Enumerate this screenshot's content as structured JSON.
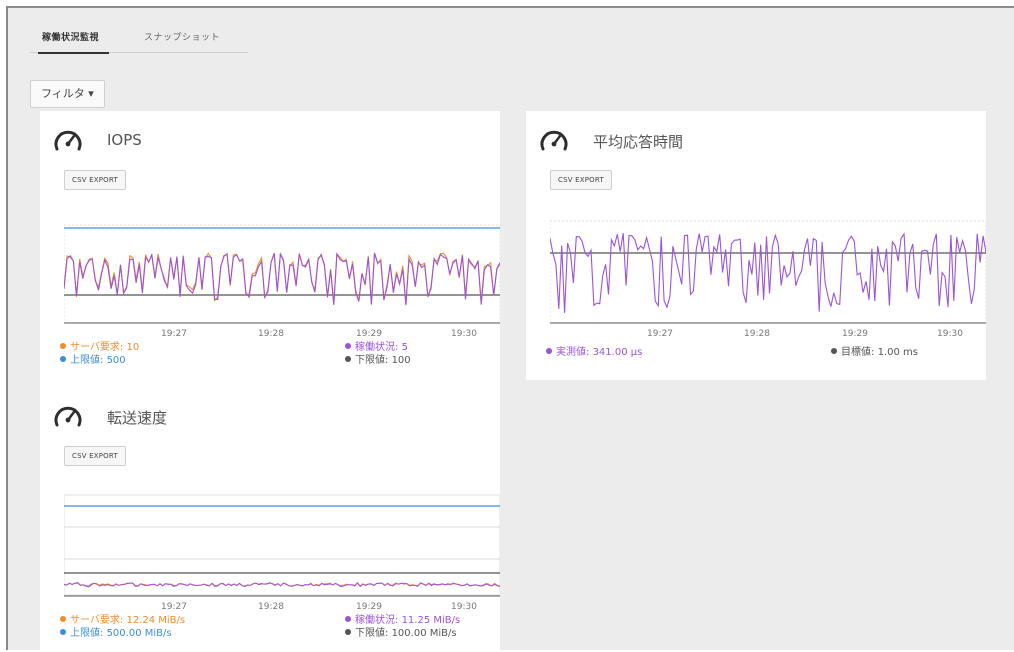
{
  "tabs": [
    {
      "label": "稼働状況監視",
      "active": true
    },
    {
      "label": "スナップショット",
      "active": false
    }
  ],
  "filter": {
    "label": "フィルタ ▾"
  },
  "colors": {
    "orange": "#f28c28",
    "purple": "#9a55d6",
    "blue": "#3c8fd6",
    "gray": "#555555",
    "band": "#e6e6e6"
  },
  "panels": [
    {
      "id": "iops",
      "title": "IOPS",
      "csv_label": "CSV EXPORT",
      "x_ticks": [
        "19:27",
        "19:28",
        "19:29",
        "19:30"
      ],
      "legend": [
        {
          "label": "サーバ要求:",
          "value": "10",
          "color": "orange"
        },
        {
          "label": "稼働状況:",
          "value": "5",
          "color": "purple"
        },
        {
          "label": "上限値:",
          "value": "500",
          "color": "blue"
        },
        {
          "label": "下限値:",
          "value": "100",
          "color": "gray"
        }
      ]
    },
    {
      "id": "response",
      "title": "平均応答時間",
      "csv_label": "CSV EXPORT",
      "x_ticks": [
        "19:27",
        "19:28",
        "19:29",
        "19:30"
      ],
      "legend": [
        {
          "label": "実測値:",
          "value": "341.00 μs",
          "color": "purple"
        },
        {
          "label": "目標値:",
          "value": "1.00 ms",
          "color": "gray"
        }
      ]
    },
    {
      "id": "transfer",
      "title": "転送速度",
      "csv_label": "CSV EXPORT",
      "x_ticks": [
        "19:27",
        "19:28",
        "19:29",
        "19:30"
      ],
      "legend": [
        {
          "label": "サーバ要求:",
          "value": "12.24 MiB/s",
          "color": "orange"
        },
        {
          "label": "稼働状況:",
          "value": "11.25 MiB/s",
          "color": "purple"
        },
        {
          "label": "上限値:",
          "value": "500.00 MiB/s",
          "color": "blue"
        },
        {
          "label": "下限値:",
          "value": "100.00 MiB/s",
          "color": "gray"
        }
      ]
    }
  ]
}
